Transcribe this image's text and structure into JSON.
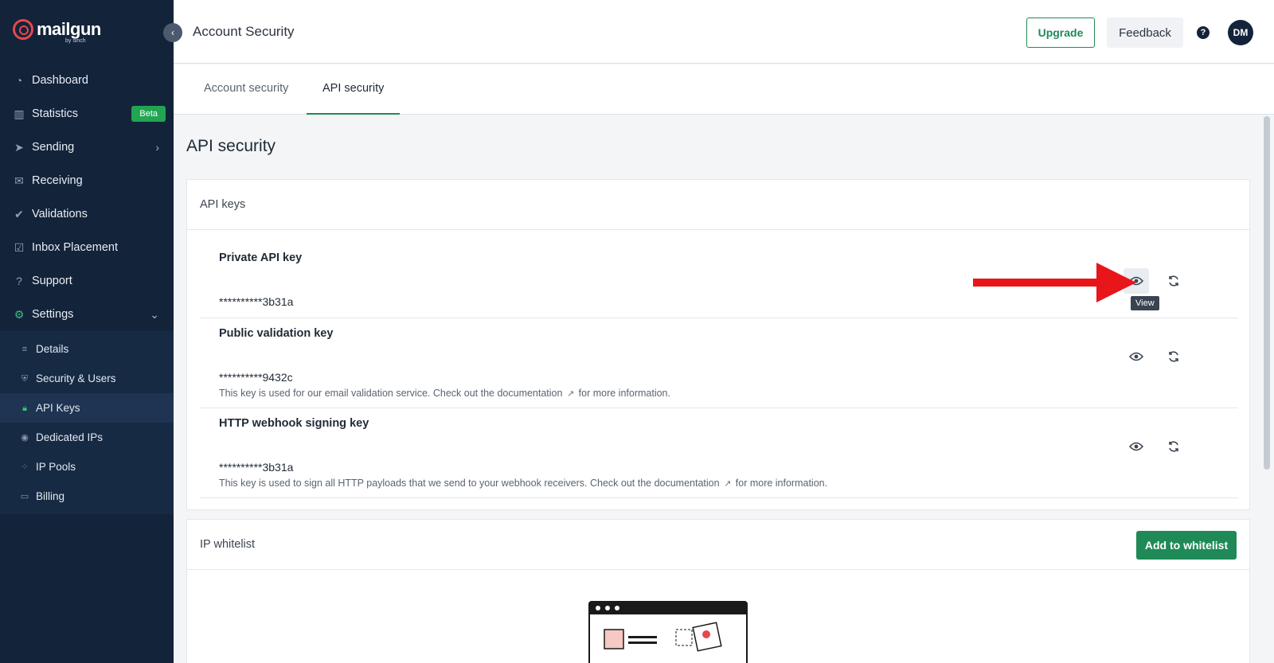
{
  "brand": {
    "name": "mailgun",
    "sub": "by sinch",
    "accent": "#e5484d"
  },
  "sidebar": {
    "items": [
      {
        "label": "Dashboard",
        "icon": "dashboard-icon"
      },
      {
        "label": "Statistics",
        "icon": "chart-bars-icon",
        "badge": "Beta"
      },
      {
        "label": "Sending",
        "icon": "paper-plane-icon"
      },
      {
        "label": "Receiving",
        "icon": "inbox-icon"
      },
      {
        "label": "Validations",
        "icon": "user-check-icon"
      },
      {
        "label": "Inbox Placement",
        "icon": "checkbox-icon"
      },
      {
        "label": "Support",
        "icon": "question-icon"
      },
      {
        "label": "Settings",
        "icon": "gear-icon"
      }
    ],
    "sub_items": [
      {
        "label": "Details",
        "icon": "sliders-icon"
      },
      {
        "label": "Security & Users",
        "icon": "shield-icon"
      },
      {
        "label": "API Keys",
        "icon": "lock-icon",
        "active": true
      },
      {
        "label": "Dedicated IPs",
        "icon": "location-icon"
      },
      {
        "label": "IP Pools",
        "icon": "pool-icon"
      },
      {
        "label": "Billing",
        "icon": "card-icon"
      }
    ]
  },
  "header": {
    "title": "Account Security",
    "upgrade": "Upgrade",
    "feedback": "Feedback",
    "help": "?",
    "avatar": "DM"
  },
  "tabs": [
    {
      "label": "Account security"
    },
    {
      "label": "API security",
      "active": true
    }
  ],
  "main": {
    "heading": "API security",
    "api_keys": {
      "title": "API keys",
      "keys": [
        {
          "title": "Private API key",
          "value": "**********3b31a",
          "desc": ""
        },
        {
          "title": "Public validation key",
          "value": "**********9432c",
          "desc_before": "This key is used for our email validation service. Check out the documentation",
          "desc_after": "for more information."
        },
        {
          "title": "HTTP webhook signing key",
          "value": "**********3b31a",
          "desc_before": "This key is used to sign all HTTP payloads that we send to your webhook receivers. Check out the documentation",
          "desc_after": "for more information."
        }
      ],
      "tooltip": "View"
    },
    "whitelist": {
      "title": "IP whitelist",
      "add_button": "Add to whitelist"
    }
  },
  "colors": {
    "sidebar_bg": "#13233a",
    "primary_green": "#1f8a57",
    "annotation_arrow": "#e8151b"
  }
}
